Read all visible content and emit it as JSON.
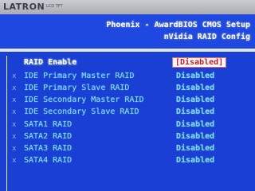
{
  "monitor": {
    "brand": "LATRON",
    "brand_suffix": "LCD TFT"
  },
  "header": {
    "title_line1": "Phoenix - AwardBIOS CMOS Setup",
    "title_line2": "nVidia RAID Config"
  },
  "settings": [
    {
      "marker": "",
      "label": "RAID Enable",
      "value": "[Disabled]"
    },
    {
      "marker": "x",
      "label": "IDE Primary Master  RAID",
      "value": "Disabled"
    },
    {
      "marker": "x",
      "label": "IDE Primary Slave   RAID",
      "value": "Disabled"
    },
    {
      "marker": "x",
      "label": "IDE Secondary Master  RAID",
      "value": "Disabled"
    },
    {
      "marker": "x",
      "label": "IDE Secondary Slave   RAID",
      "value": "Disabled"
    },
    {
      "marker": "x",
      "label": "SATA1 RAID",
      "value": "Disabled"
    },
    {
      "marker": "x",
      "label": "SATA2 RAID",
      "value": "Disabled"
    },
    {
      "marker": "x",
      "label": "SATA3 RAID",
      "value": "Disabled"
    },
    {
      "marker": "x",
      "label": "SATA4 RAID",
      "value": "Disabled"
    }
  ],
  "colors": {
    "background": "#1a3fd4",
    "text_disabled": "#7fd8ff",
    "text_active": "#ffffff",
    "highlight_text": "#d01818"
  }
}
